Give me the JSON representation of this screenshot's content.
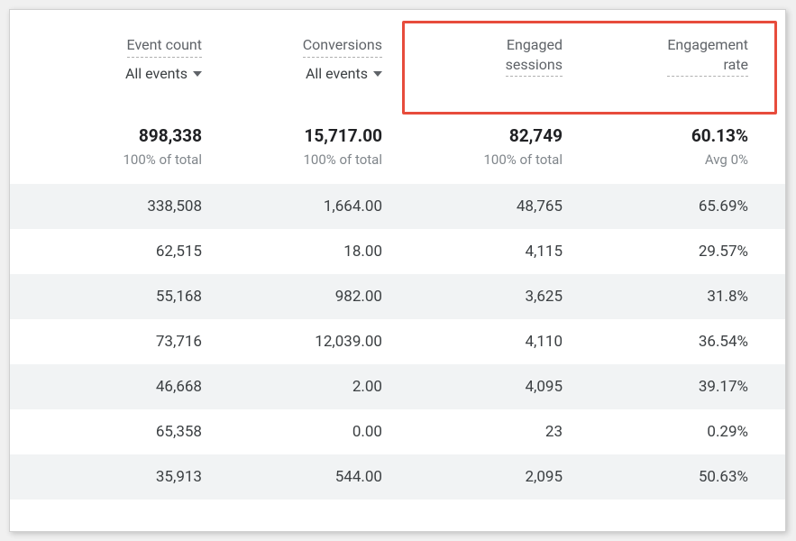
{
  "headers": {
    "event_count": "Event count",
    "conversions": "Conversions",
    "engaged_sessions": "Engaged sessions",
    "engagement_rate": "Engagement rate",
    "filter_label": "All events"
  },
  "summary": {
    "event_count": "898,338",
    "conversions": "15,717.00",
    "engaged_sessions": "82,749",
    "engagement_rate": "60.13%",
    "sub_event_count": "100% of total",
    "sub_conversions": "100% of total",
    "sub_engaged_sessions": "100% of total",
    "sub_engagement_rate": "Avg 0%"
  },
  "rows": [
    {
      "event_count": "338,508",
      "conversions": "1,664.00",
      "engaged_sessions": "48,765",
      "engagement_rate": "65.69%"
    },
    {
      "event_count": "62,515",
      "conversions": "18.00",
      "engaged_sessions": "4,115",
      "engagement_rate": "29.57%"
    },
    {
      "event_count": "55,168",
      "conversions": "982.00",
      "engaged_sessions": "3,625",
      "engagement_rate": "31.8%"
    },
    {
      "event_count": "73,716",
      "conversions": "12,039.00",
      "engaged_sessions": "4,110",
      "engagement_rate": "36.54%"
    },
    {
      "event_count": "46,668",
      "conversions": "2.00",
      "engaged_sessions": "4,095",
      "engagement_rate": "39.17%"
    },
    {
      "event_count": "65,358",
      "conversions": "0.00",
      "engaged_sessions": "23",
      "engagement_rate": "0.29%"
    },
    {
      "event_count": "35,913",
      "conversions": "544.00",
      "engaged_sessions": "2,095",
      "engagement_rate": "50.63%"
    }
  ]
}
